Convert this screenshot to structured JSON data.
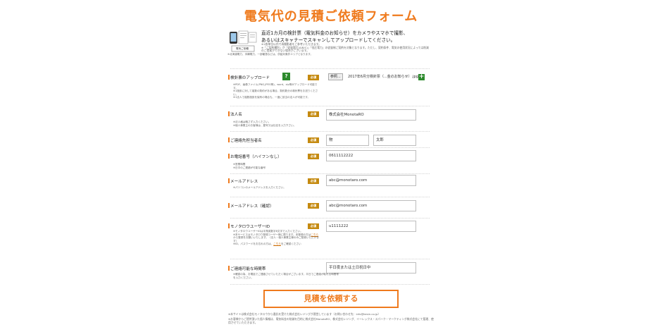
{
  "page": {
    "title": "電気代の見積ご依頼フォーム"
  },
  "intro": {
    "image_badge": "電気ご依頼",
    "main_line1": "直近1カ月の検針票（電気料金のお知らせ）をカメラやスマホで撮影、",
    "main_line2": "あるいはスキャナーでスキャンしてアップロードしてください。",
    "note_line1": "※1枚単位以内で再撮影者をご参考いただきます。",
    "note_line2": "※「ご契約種別」が「従量電灯(A/B/C)」「低圧電力」の従量制ご契約を対象となります。ただし、契約条件、電気の使用状況によっては削減",
    "note_line3": "のご提案ができない場合がございます。",
    "note_line4": "※北海道電力、沖縄電力、一部離島などは、供給対象外エリアとなります。"
  },
  "form": {
    "required_label": "必須",
    "help_icon_label": "?",
    "upload": {
      "label": "検針票のアップロード",
      "button": "参照...",
      "filename": "2017年6月分検針票（...金のお知らせ）.jpg",
      "add_label": "+",
      "note1": "※PDF、画像ファイル(PNG,JPEG等)、word、zip等がアップロード可能です。",
      "note2": "※1施設に対して複数の契約がある場合、契約数分の検針票をお送りください。",
      "note3": "※1法人で複数施設を保有の場合も、一度に該当の法人が可能です。"
    },
    "company": {
      "label": "法人名",
      "value": "株式会社MonotaRO",
      "note1": "※法人格は略さず入力ください。",
      "note2": "※個人事業主のお客様は、屋号又は社名を入力下さい。"
    },
    "contact_name": {
      "label": "ご連絡先担当者名",
      "last": "物",
      "first": "太郎"
    },
    "phone": {
      "label": "お電話番号（ハイフンなし）",
      "value": "0611112222",
      "note1": "※営業時間",
      "note2": "※日中のご連絡が可能な番号"
    },
    "email": {
      "label": "メールアドレス",
      "value": "abc@monotaro.com",
      "note1": "※パソコンのメールアドレスを入力ください。"
    },
    "email_confirm": {
      "label": "メールアドレス（確認）",
      "value": "abc@monotaro.com"
    },
    "user_id": {
      "label": "モノタロウユーザーID",
      "value": "u1111222",
      "note1": "※モノタロウユーザーIDは半角英数字8文字で入力ください。",
      "note2a": "※本サービスはモノタロウ登録ユーザー様に限ります。未登録の方は",
      "note2_link": "こちら",
      "note3": "から登録をお願いいたします。（法人・個人事業主様のみご登録いただけます）",
      "note4a": "※ID、パスワードをお忘れの方は、",
      "note4_link": "こちら",
      "note4b": "をご確認ください"
    },
    "contact_time": {
      "label": "ご連絡可能な時間帯",
      "value": "平日夜または土日祝日中",
      "note1": "※確認の為、お電話でご連絡させていただく場合がございます。平日でご連絡が取れる時間帯を入力ください。"
    },
    "submit_label": "見積を依頼する"
  },
  "footer": {
    "line1": "※本サイトは株式会社モノタロウから委託を受けた株式会社レジングが運営しています（お問い合わせ先：info@kesin.co.jp）",
    "line2": "※お客様からご提供頂いた個人情報は、電気料金の削減を目的に株式会社MonotaRO、株式会社レジング、イーレックス・スパーク・マーケティング株式会社にて管理、使用させていただきます。"
  }
}
